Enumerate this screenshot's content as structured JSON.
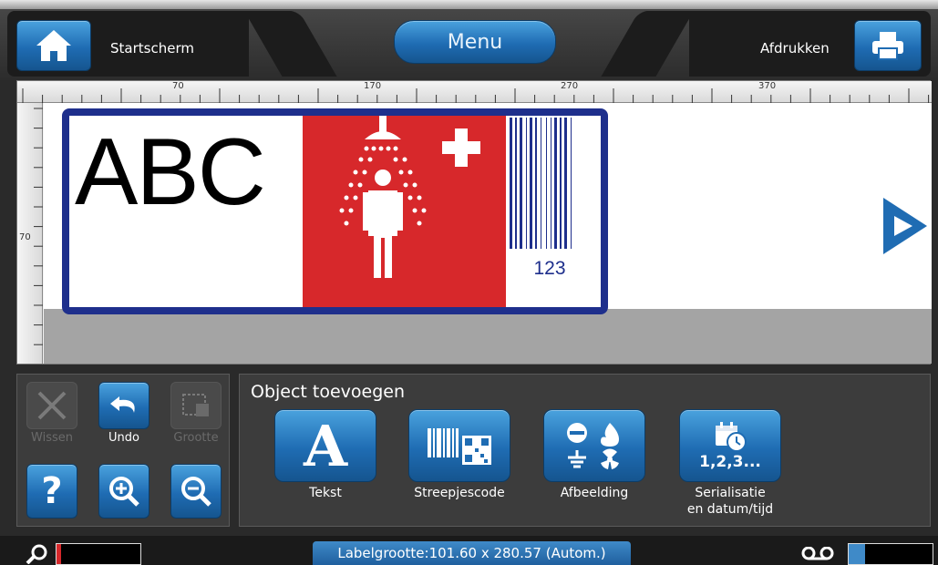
{
  "header": {
    "home_label": "Startscherm",
    "menu_label": "Menu",
    "print_label": "Afdrukken",
    "accent_color": "#1f6cb3",
    "home_icon": "home-icon",
    "print_icon": "printer-icon"
  },
  "ruler": {
    "horizontal_labels": [
      "70",
      "170",
      "270",
      "370"
    ],
    "vertical_labels": [
      "70"
    ]
  },
  "label_preview": {
    "text": "ABC",
    "barcode_number": "123",
    "border_color": "#1e2f8c",
    "panel_color": "#d7282b",
    "image_icon": "emergency-shower-icon"
  },
  "edit_tools": [
    {
      "label": "Wissen",
      "icon": "delete-x-icon",
      "enabled": false
    },
    {
      "label": "Undo",
      "icon": "undo-icon",
      "enabled": true
    },
    {
      "label": "Grootte",
      "icon": "resize-icon",
      "enabled": false
    },
    {
      "label": "",
      "icon": "help-icon",
      "enabled": true
    },
    {
      "label": "",
      "icon": "zoom-in-icon",
      "enabled": true
    },
    {
      "label": "",
      "icon": "zoom-out-icon",
      "enabled": true
    }
  ],
  "add_object": {
    "title": "Object toevoegen",
    "items": [
      {
        "label": "Tekst",
        "icon": "text-icon"
      },
      {
        "label": "Streepjescode",
        "icon": "barcode-icon"
      },
      {
        "label": "Afbeelding",
        "icon": "image-symbols-icon"
      },
      {
        "label": "Serialisatie\nen datum/tijd",
        "icon": "serialization-date-icon",
        "icon_text": "1,2,3..."
      }
    ]
  },
  "status": {
    "label_size": "Labelgrootte:101.60 x 280.57 (Autom.)",
    "ribbon_level": 0.05,
    "tape_level": 0.2,
    "ribbon_color": "#d7282b",
    "tape_color": "#3f8ac8"
  }
}
